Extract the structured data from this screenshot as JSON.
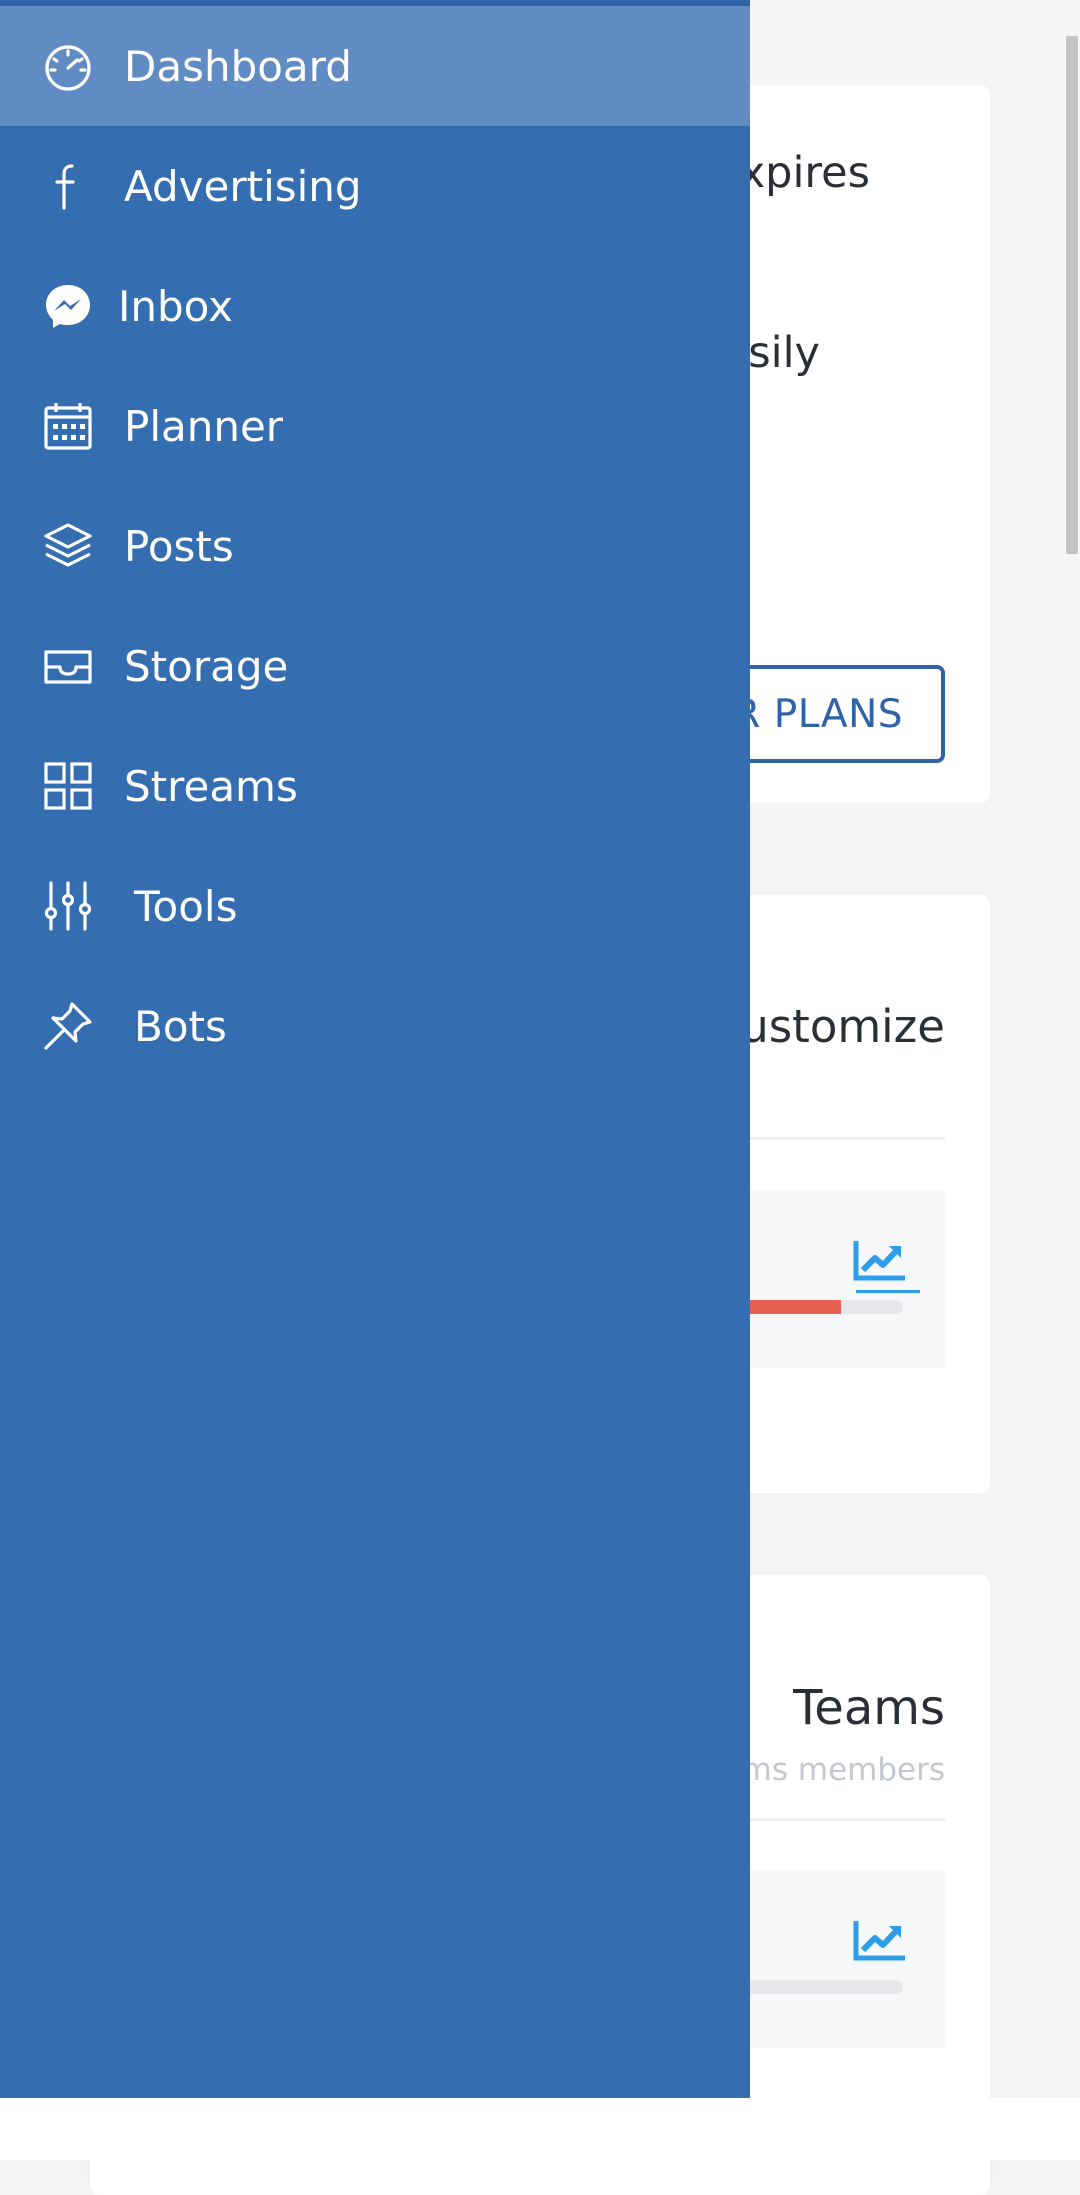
{
  "sidebar": {
    "items": [
      {
        "label": "Dashboard",
        "icon": "speedometer-icon",
        "active": true
      },
      {
        "label": "Advertising",
        "icon": "facebook-icon"
      },
      {
        "label": "Inbox",
        "icon": "messenger-icon"
      },
      {
        "label": "Planner",
        "icon": "calendar-icon"
      },
      {
        "label": "Posts",
        "icon": "layers-icon"
      },
      {
        "label": "Storage",
        "icon": "inbox-tray-icon"
      },
      {
        "label": "Streams",
        "icon": "grid-icon"
      },
      {
        "label": "Tools",
        "icon": "sliders-icon"
      },
      {
        "label": "Bots",
        "icon": "pin-icon"
      }
    ],
    "colors": {
      "background": "#346db0",
      "active": "#608bc3"
    }
  },
  "background": {
    "plan_card": {
      "text_expires": "xpires",
      "text_easily": "sily",
      "plans_button": "R PLANS"
    },
    "customize_card": {
      "title": "ustomize",
      "progress": 0.88,
      "progress_color": "#e8604f",
      "trend_icon": "chart-line-icon"
    },
    "teams_card": {
      "title": "Teams",
      "subtitle": "ms members",
      "progress": 0,
      "trend_icon": "chart-line-icon"
    }
  }
}
